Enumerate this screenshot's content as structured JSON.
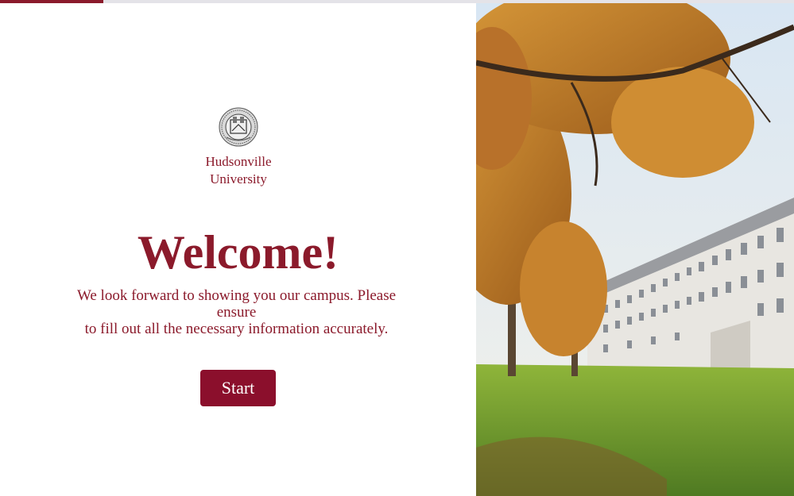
{
  "progress": {
    "value": 0.13
  },
  "brand": {
    "logo_icon": "university-seal-icon",
    "name_line1": "Hudsonville",
    "name_line2": "University"
  },
  "welcome": {
    "title": "Welcome!",
    "subtitle_line1": "We look forward to showing you our campus. Please ensure",
    "subtitle_line2": "to fill out all the necessary information accurately."
  },
  "actions": {
    "start_label": "Start"
  },
  "hero_image": {
    "icon": "campus-autumn-photo"
  },
  "colors": {
    "accent": "#8b1a2b",
    "button": "#8b0f2c",
    "track": "#e4e3e8"
  }
}
